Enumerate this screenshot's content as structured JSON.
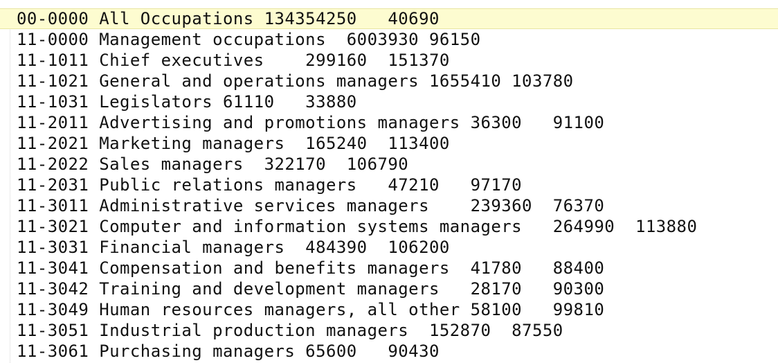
{
  "editor": {
    "highlight_color": "#fdfcd0",
    "current_line_index": 0,
    "lines": [
      "00-0000 All Occupations 134354250   40690",
      "11-0000 Management occupations  6003930 96150",
      "11-1011 Chief executives    299160  151370",
      "11-1021 General and operations managers 1655410 103780",
      "11-1031 Legislators 61110   33880",
      "11-2011 Advertising and promotions managers 36300   91100",
      "11-2021 Marketing managers  165240  113400",
      "11-2022 Sales managers  322170  106790",
      "11-2031 Public relations managers   47210   97170",
      "11-3011 Administrative services managers    239360  76370",
      "11-3021 Computer and information systems managers   264990  113880",
      "11-3031 Financial managers  484390  106200",
      "11-3041 Compensation and benefits managers  41780   88400",
      "11-3042 Training and development managers   28170   90300",
      "11-3049 Human resources managers, all other 58100   99810",
      "11-3051 Industrial production managers  152870  87550",
      "11-3061 Purchasing managers 65600   90430"
    ]
  }
}
